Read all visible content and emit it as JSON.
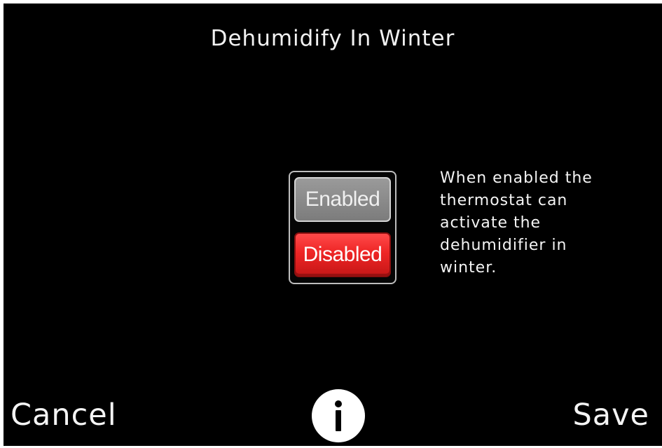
{
  "header": {
    "title": "Dehumidify In Winter"
  },
  "toggle": {
    "options": [
      {
        "label": "Enabled",
        "selected": false
      },
      {
        "label": "Disabled",
        "selected": true
      }
    ],
    "selected_color": "#ee2525",
    "unselected_color": "#8a8a8a"
  },
  "description": "When enabled the\nthermostat can\nactivate the\ndehumidifier in\nwinter.",
  "footer": {
    "cancel_label": "Cancel",
    "info_icon": "info-icon",
    "save_label": "Save"
  },
  "colors": {
    "background": "#000000",
    "text": "#ffffff"
  }
}
